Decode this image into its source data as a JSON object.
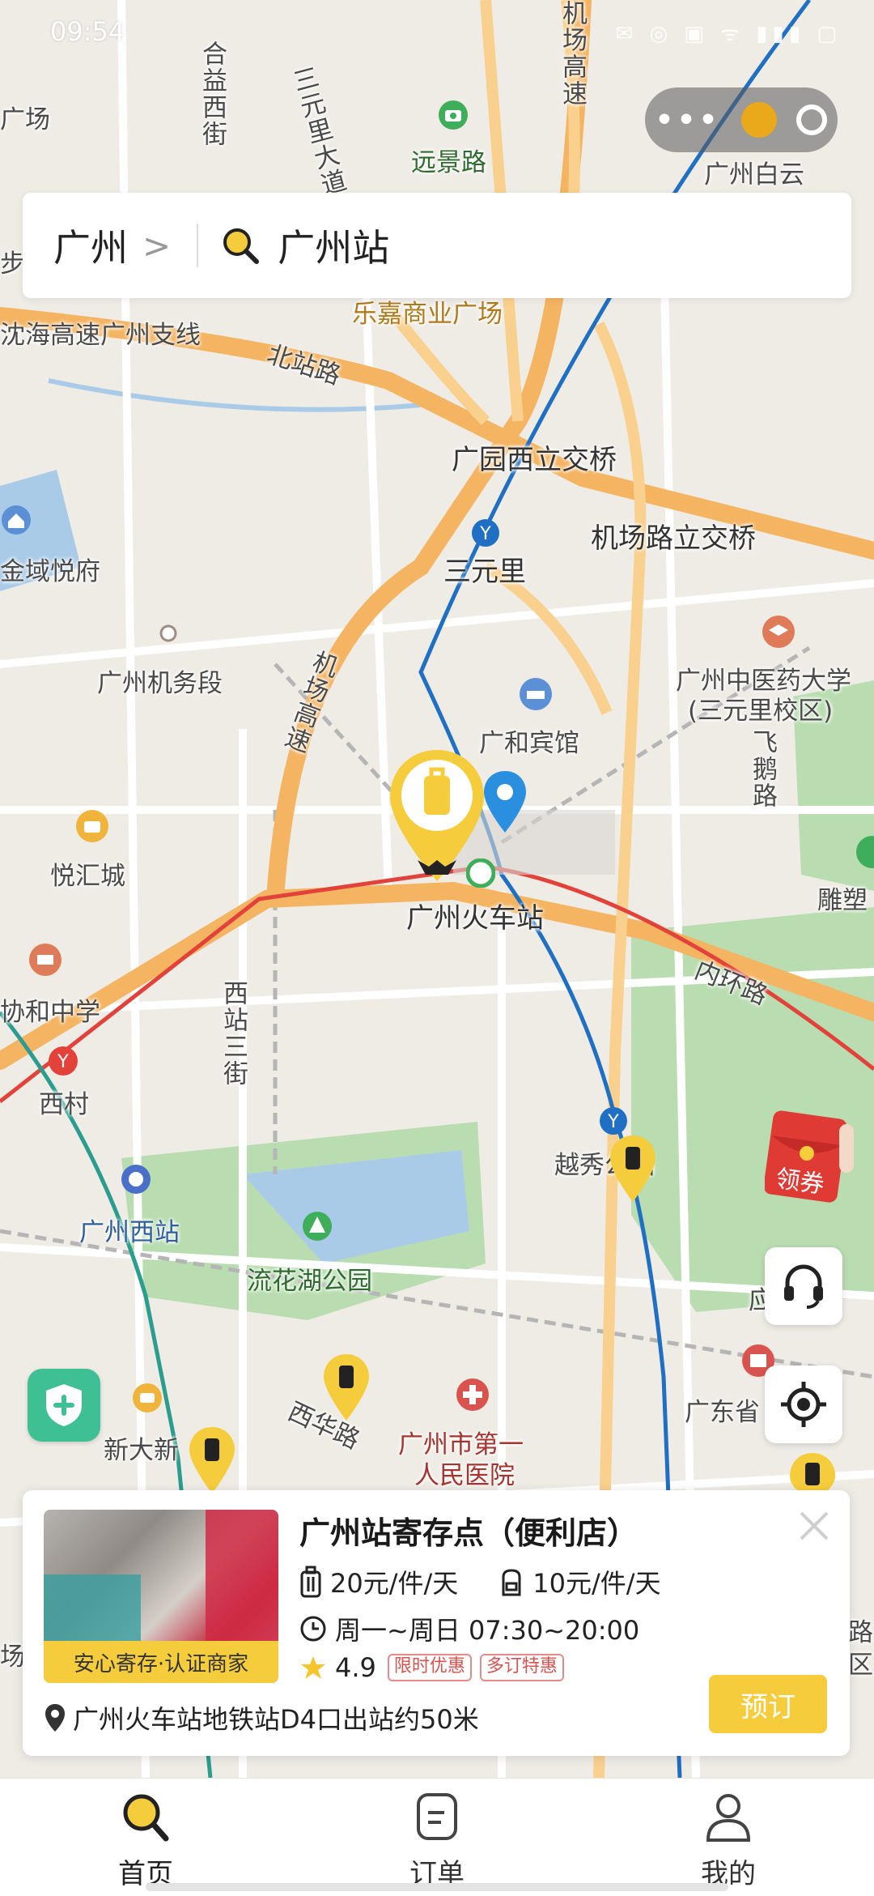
{
  "status_bar": {
    "time": "09:54",
    "icons": "✉ ◎ ▣ ᯤ ▮▮▮ ▢"
  },
  "capsule": {
    "more": "•••"
  },
  "search": {
    "city": "广州",
    "chevron": ">",
    "query": "广州站"
  },
  "map": {
    "labels": {
      "hebixi": "合益西街",
      "sanyuanli_road": "三元里大道",
      "airport_hwy_n": "机场高速",
      "yuanjing": "远景路",
      "baiyun": "广州白云",
      "guang_top": "广场",
      "bu": "步",
      "lejia": "乐嘉商业广场",
      "shenhai": "沈海高速广州支线",
      "beizhan": "北站路",
      "guangyuan": "广园西立交桥",
      "jichang_jiao": "机场路立交桥",
      "jinyu": "金域悦府",
      "sanyuanli": "三元里",
      "jiwuduan": "广州机务段",
      "airport_hwy": "机场高速",
      "tcm1": "广州中医药大学",
      "tcm2": "(三元里校区)",
      "guanghe": "广和宾馆",
      "feie": "飞鹅路",
      "yuehui": "悦汇城",
      "station": "广州火车站",
      "diao": "雕塑",
      "neihuan": "内环路",
      "xiehe": "协和中学",
      "xizhan_st": "西站三街",
      "xicun": "西村",
      "yuexiu": "越秀公园",
      "xizhan": "广州西站",
      "liuhua": "流花湖公园",
      "xinda": "新大新",
      "xihua": "西华路",
      "hospital1": "广州市第一",
      "hospital2": "人民医院",
      "guangdong": "广东省",
      "chang": "场",
      "lu_right1": "路",
      "lu_right2": "区",
      "tiao": "应"
    }
  },
  "buttons": {
    "coupon": "领券"
  },
  "card": {
    "badge": "安心寄存·认证商家",
    "name": "广州站寄存点（便利店）",
    "price_luggage": "20元/件/天",
    "price_bag": "10元/件/天",
    "hours": "周一~周日 07:30~20:00",
    "rating": "4.9",
    "tag1": "限时优惠",
    "tag2": "多订特惠",
    "address": "广州火车站地铁站D4口出站约50米",
    "book": "预订"
  },
  "tabs": [
    {
      "label": "首页"
    },
    {
      "label": "订单"
    },
    {
      "label": "我的"
    }
  ],
  "colors": {
    "accent": "#f5cd3c",
    "map_bg": "#efece6",
    "park": "#b9ddb0",
    "water": "#a9cbe8",
    "metro_blue": "#1f6fc4",
    "metro_red": "#e3423b"
  }
}
